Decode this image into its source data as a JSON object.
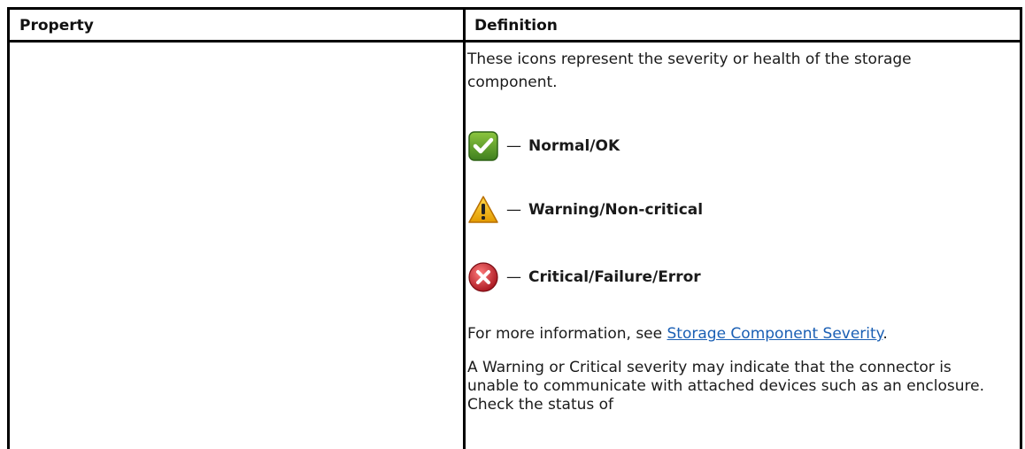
{
  "table": {
    "headers": {
      "property": "Property",
      "definition": "Definition"
    },
    "intro": "These icons represent the severity or health of the storage component.",
    "dash": "—",
    "severities": [
      {
        "icon": "checkmark-icon",
        "label": "Normal/OK",
        "color": "#4f9a2b"
      },
      {
        "icon": "warning-triangle-icon",
        "label": "Warning/Non-critical",
        "color": "#f2b705"
      },
      {
        "icon": "error-x-icon",
        "label": "Critical/Failure/Error",
        "color": "#c0202a"
      }
    ],
    "more_info_prefix": "For more information, see ",
    "more_info_link": "Storage Component Severity",
    "more_info_suffix": ".",
    "note": "A Warning or Critical severity may indicate that the connector is unable to communicate with attached devices such as an enclosure. Check the status of"
  }
}
